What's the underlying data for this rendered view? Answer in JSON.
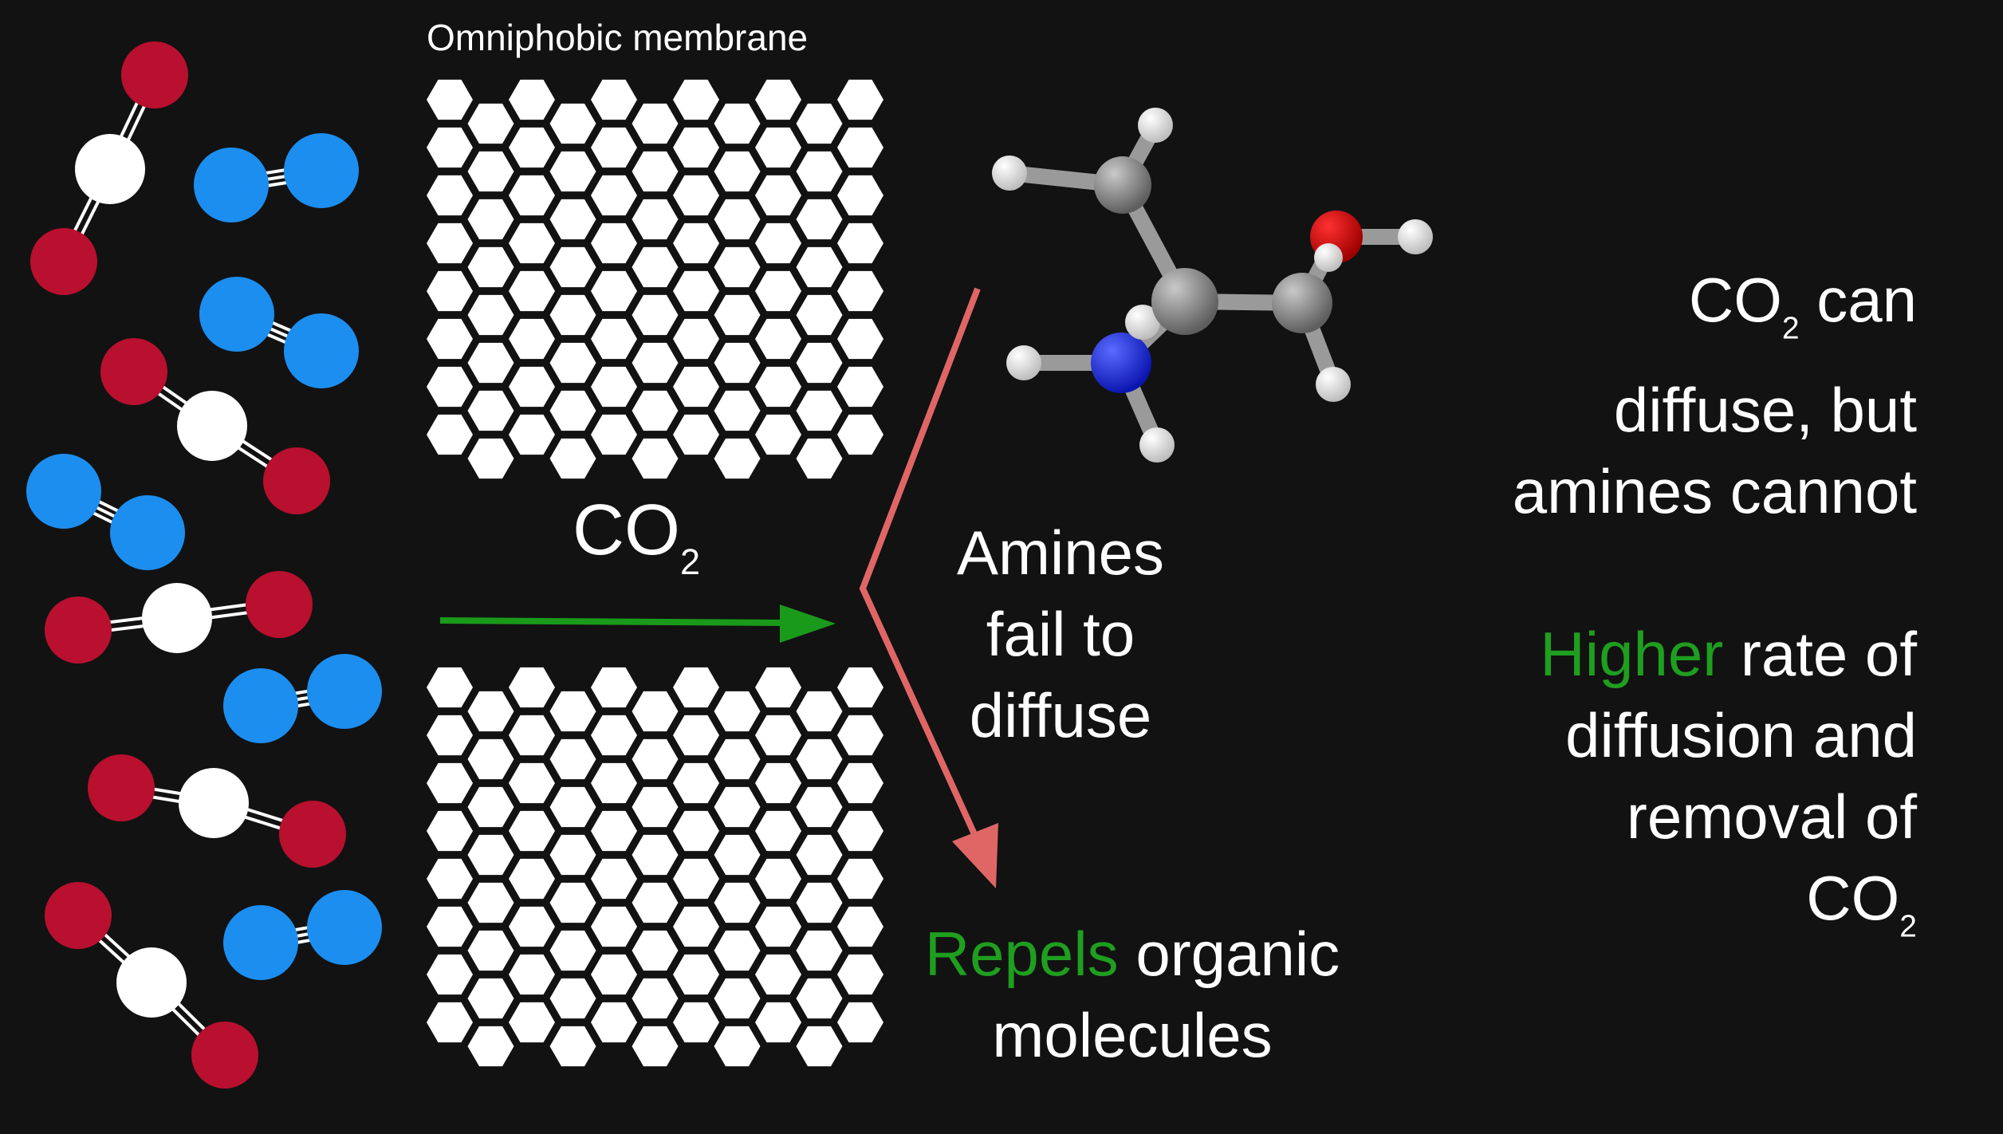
{
  "membrane": {
    "label": "Omniphobic membrane"
  },
  "flow": {
    "label_main": "CO",
    "label_sub": "2"
  },
  "amine_note": {
    "lines": [
      "Amines",
      "fail to",
      "diffuse"
    ]
  },
  "repel_note": {
    "accent": "Repels",
    "rest_line1": " organic",
    "line2": "molecules"
  },
  "summary": {
    "line1_main": "CO",
    "line1_sub": "2",
    "line1_rest": " can",
    "line2": "diffuse, but",
    "line3": "amines cannot",
    "accent": "Higher",
    "line4_rest": " rate of",
    "line5": "diffusion and",
    "line6": "removal of",
    "line7_main": "CO",
    "line7_sub": "2"
  },
  "colors": {
    "background": "#121212",
    "oxygen": "#b8102e",
    "carbon": "#ffffff",
    "nitrogen": "#1c8ef0",
    "flow_arrow": "#1a9a1a",
    "deflect_arrow": "#e06666",
    "accent": "#1f9e1f"
  },
  "icons": {
    "co2_molecule": "co2-molecule-icon",
    "n2_molecule": "n2-molecule-icon",
    "amine_molecule": "ethanolamine-molecule-icon",
    "membrane": "hexagon-membrane-icon"
  }
}
